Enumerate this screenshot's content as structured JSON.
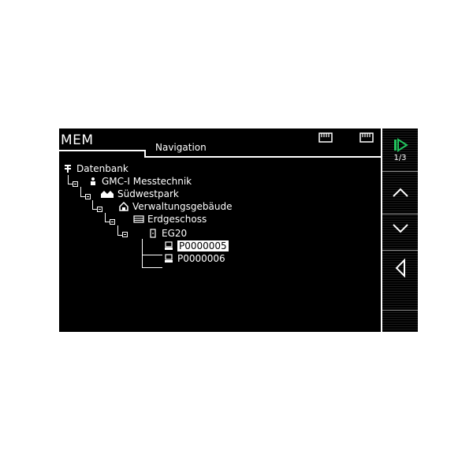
{
  "header": {
    "app_title": "MEM",
    "page_title": "Navigation",
    "status_icons": [
      "memory-card-icon",
      "memory-card-icon"
    ]
  },
  "tree": {
    "items": [
      {
        "label": "Datenbank",
        "icon": "database-icon",
        "level": 0,
        "selected": false
      },
      {
        "label": "GMC-I Messtechnik",
        "icon": "person-icon",
        "level": 1,
        "selected": false
      },
      {
        "label": "Südwestpark",
        "icon": "houses-icon",
        "level": 2,
        "selected": false
      },
      {
        "label": "Verwaltungsgebäude",
        "icon": "building-icon",
        "level": 3,
        "selected": false
      },
      {
        "label": "Erdgeschoss",
        "icon": "floor-icon",
        "level": 4,
        "selected": false
      },
      {
        "label": "EG20",
        "icon": "room-icon",
        "level": 5,
        "selected": false
      },
      {
        "label": "P0000005",
        "icon": "device-icon",
        "level": 6,
        "selected": true
      },
      {
        "label": "P0000006",
        "icon": "device-icon",
        "level": 6,
        "selected": false
      }
    ]
  },
  "side_panel": {
    "page_indicator": "1/3",
    "buttons": [
      "next-page",
      "up",
      "down",
      "back"
    ],
    "accent_color": "#22c55e"
  }
}
